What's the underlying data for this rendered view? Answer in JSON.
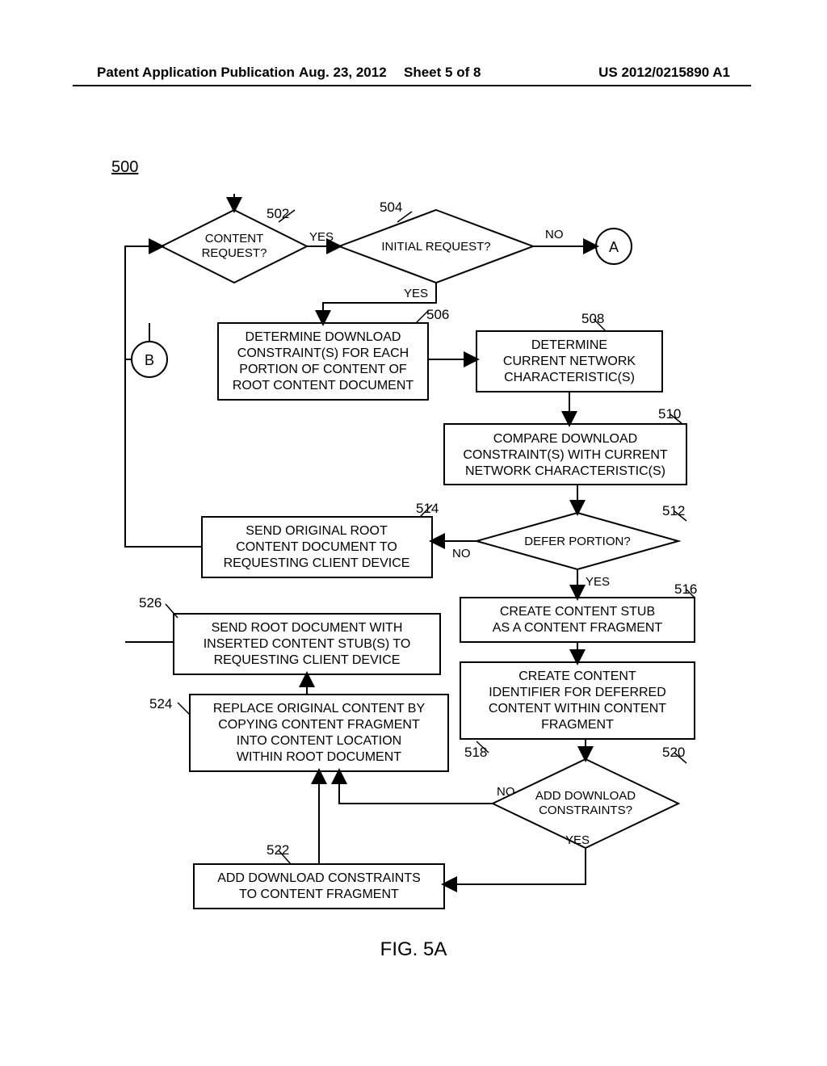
{
  "header": {
    "left": "Patent Application Publication",
    "date": "Aug. 23, 2012",
    "sheet": "Sheet 5 of 8",
    "pubno": "US 2012/0215890 A1"
  },
  "figure": {
    "number": "500",
    "caption": "FIG. 5A"
  },
  "refs": {
    "r502": "502",
    "r504": "504",
    "r506": "506",
    "r508": "508",
    "r510": "510",
    "r512": "512",
    "r514": "514",
    "r516": "516",
    "r518": "518",
    "r520": "520",
    "r522": "522",
    "r524": "524",
    "r526": "526"
  },
  "nodes": {
    "d502": {
      "l1": "CONTENT",
      "l2": "REQUEST?"
    },
    "d504": {
      "l1": "INITIAL REQUEST?"
    },
    "connA": "A",
    "connB": "B",
    "b506": {
      "l1": "DETERMINE DOWNLOAD",
      "l2": "CONSTRAINT(S) FOR EACH",
      "l3": "PORTION OF CONTENT OF",
      "l4": "ROOT CONTENT DOCUMENT"
    },
    "b508": {
      "l1": "DETERMINE",
      "l2": "CURRENT NETWORK",
      "l3": "CHARACTERISTIC(S)"
    },
    "b510": {
      "l1": "COMPARE DOWNLOAD",
      "l2": "CONSTRAINT(S) WITH CURRENT",
      "l3": "NETWORK CHARACTERISTIC(S)"
    },
    "d512": {
      "l1": "DEFER PORTION?"
    },
    "b514": {
      "l1": "SEND ORIGINAL ROOT",
      "l2": "CONTENT DOCUMENT TO",
      "l3": "REQUESTING CLIENT DEVICE"
    },
    "b516": {
      "l1": "CREATE CONTENT STUB",
      "l2": "AS A CONTENT FRAGMENT"
    },
    "b518": {
      "l1": "CREATE CONTENT",
      "l2": "IDENTIFIER FOR DEFERRED",
      "l3": "CONTENT WITHIN CONTENT",
      "l4": "FRAGMENT"
    },
    "d520": {
      "l1": "ADD DOWNLOAD",
      "l2": "CONSTRAINTS?"
    },
    "b522": {
      "l1": "ADD DOWNLOAD CONSTRAINTS",
      "l2": "TO CONTENT FRAGMENT"
    },
    "b524": {
      "l1": "REPLACE ORIGINAL CONTENT BY",
      "l2": "COPYING CONTENT FRAGMENT",
      "l3": "INTO CONTENT LOCATION",
      "l4": "WITHIN ROOT DOCUMENT"
    },
    "b526": {
      "l1": "SEND ROOT DOCUMENT WITH",
      "l2": "INSERTED CONTENT STUB(S) TO",
      "l3": "REQUESTING CLIENT DEVICE"
    }
  },
  "edges": {
    "yes": "YES",
    "no": "NO"
  }
}
